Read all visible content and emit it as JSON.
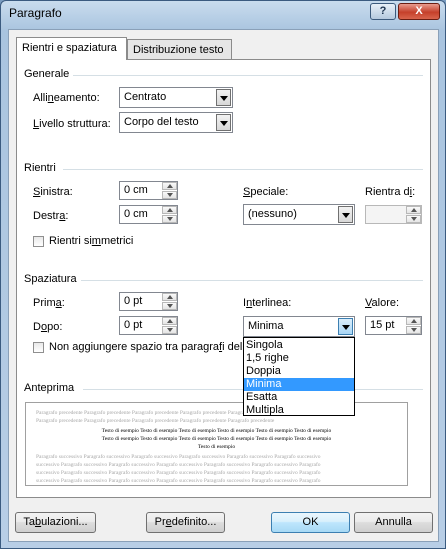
{
  "window": {
    "title": "Paragrafo",
    "help_label": "?",
    "close_label": "X"
  },
  "tabs": [
    {
      "label": "Rientri e spaziatura"
    },
    {
      "label": "Distribuzione testo"
    }
  ],
  "generale": {
    "title": "Generale",
    "allineamento_label_pre": "Alli",
    "allineamento_label_ul": "n",
    "allineamento_label_post": "eamento:",
    "allineamento_value": "Centrato",
    "livello_label_pre": "",
    "livello_label_ul": "L",
    "livello_label_post": "ivello struttura:",
    "livello_value": "Corpo del testo"
  },
  "rientri": {
    "title": "Rientri",
    "sinistra_ul": "S",
    "sinistra_post": "inistra:",
    "sinistra_value": "0 cm",
    "destra_pre": "Destr",
    "destra_ul": "a",
    "destra_post": ":",
    "destra_value": "0 cm",
    "speciale_pre": "",
    "speciale_ul": "S",
    "speciale_post": "peciale:",
    "speciale_value": "(nessuno)",
    "rientra_pre": "Rientra d",
    "rientra_ul": "i",
    "rientra_post": ":",
    "rientra_value": "",
    "simmetrici_pre": "Rientri si",
    "simmetrici_ul": "m",
    "simmetrici_post": "metrici"
  },
  "spaziatura": {
    "title": "Spaziatura",
    "prima_pre": "Prim",
    "prima_ul": "a",
    "prima_post": ":",
    "prima_value": "0 pt",
    "dopo_pre": "D",
    "dopo_ul": "o",
    "dopo_post": "po:",
    "dopo_value": "0 pt",
    "interlinea_pre": "I",
    "interlinea_ul": "n",
    "interlinea_post": "terlinea:",
    "interlinea_value": "Minima",
    "valore_pre": "",
    "valore_ul": "V",
    "valore_post": "alore:",
    "valore_value": "15 pt",
    "no_space_pre": "Non aggiungere spazio tra paragra",
    "no_space_ul": "f",
    "no_space_post": "i dell",
    "interlinea_options": [
      "Singola",
      "1,5 righe",
      "Doppia",
      "Minima",
      "Esatta",
      "Multipla"
    ],
    "interlinea_selected": "Minima"
  },
  "anteprima": {
    "title": "Anteprima",
    "prev_lines": [
      "Paragrafo precedente Paragrafo precedente Paragrafo precedente Paragrafo precedente Paragrafo precedente Paragrafo precedente",
      "Paragrafo precedente Paragrafo precedente Paragrafo precedente Paragrafo precedente Paragrafo precedente"
    ],
    "sample_lines": [
      "Testo di esempio Testo di esempio Testo di esempio Testo di esempio Testo di esempio Testo di esempio",
      "Testo di esempio Testo di esempio Testo di esempio Testo di esempio Testo di esempio Testo di esempio",
      "Testo di esempio"
    ],
    "next_lines": [
      "Paragrafo successivo Paragrafo successivo Paragrafo successivo Paragrafo successivo Paragrafo successivo Paragrafo successivo",
      "successivo Paragrafo successivo Paragrafo successivo Paragrafo successivo Paragrafo successivo Paragrafo successivo Paragrafo",
      "successivo Paragrafo successivo Paragrafo successivo Paragrafo successivo Paragrafo successivo Paragrafo successivo Paragrafo",
      "successivo Paragrafo successivo Paragrafo successivo Paragrafo successivo Paragrafo successivo Paragrafo successivo Paragrafo"
    ]
  },
  "buttons": {
    "tabulazioni_pre": "Ta",
    "tabulazioni_ul": "b",
    "tabulazioni_post": "ulazioni...",
    "predefinito_pre": "Pr",
    "predefinito_ul": "e",
    "predefinito_post": "definito...",
    "ok": "OK",
    "annulla": "Annulla"
  }
}
